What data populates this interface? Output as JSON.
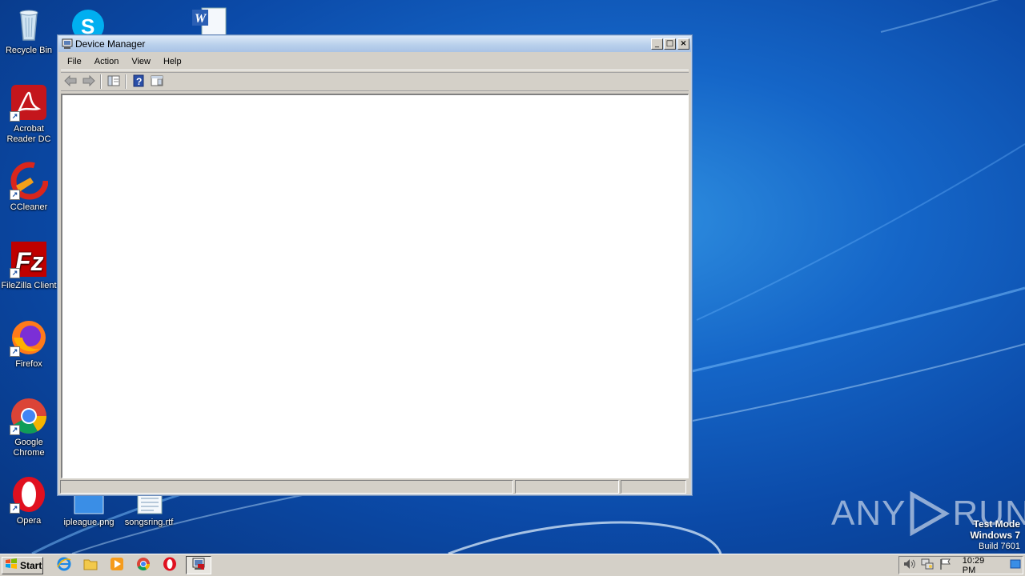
{
  "desktop": {
    "icons": [
      {
        "label": "Recycle Bin",
        "icon": "recycle-bin-icon"
      },
      {
        "label": "Acrobat Reader DC",
        "icon": "acrobat-icon"
      },
      {
        "label": "CCleaner",
        "icon": "ccleaner-icon"
      },
      {
        "label": "FileZilla Client",
        "icon": "filezilla-icon"
      },
      {
        "label": "Firefox",
        "icon": "firefox-icon"
      },
      {
        "label": "Google Chrome",
        "icon": "chrome-icon"
      },
      {
        "label": "Opera",
        "icon": "opera-icon"
      },
      {
        "label": "ipleague.png",
        "icon": "image-file-icon"
      },
      {
        "label": "songsring.rtf",
        "icon": "rtf-file-icon"
      }
    ]
  },
  "window": {
    "title": "Device Manager",
    "controls": {
      "minimize": "_",
      "maximize": "□",
      "close": "×"
    },
    "menu": [
      "File",
      "Action",
      "View",
      "Help"
    ],
    "toolbar": [
      "back-icon",
      "forward-icon",
      "show-hide-tree-icon",
      "help-icon",
      "properties-icon"
    ]
  },
  "watermark": {
    "brand": "ANY",
    "brand_suffix": "RUN"
  },
  "test_mode": {
    "line1": "Test Mode",
    "line2": "Windows 7",
    "line3": "Build 7601"
  },
  "taskbar": {
    "start_label": "Start",
    "clock": "10:29 PM"
  },
  "colors": {
    "wallpaper": "#1566c8",
    "chrome": "#d4d0c8",
    "title_gradient": "#b9d0ec"
  }
}
